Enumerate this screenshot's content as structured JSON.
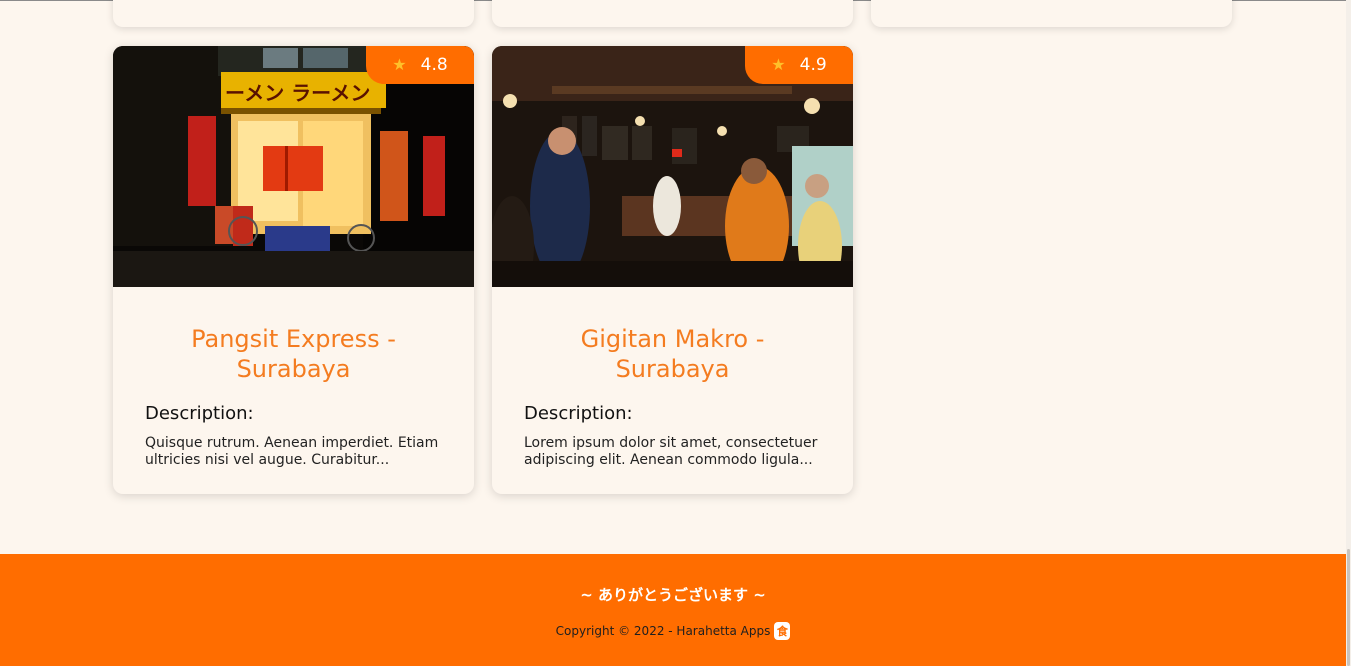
{
  "colors": {
    "accent": "#ff6d00",
    "title": "#f47c20",
    "star": "#ffc02a",
    "background": "#fdf6ee"
  },
  "cards": [
    {
      "name": "Pangsit Express - Surabaya",
      "rating": "4.8",
      "description_label": "Description:",
      "description": "Quisque rutrum. Aenean imperdiet. Etiam ultricies nisi vel augue. Curabitur...",
      "image": "ramen-shop-night-photo"
    },
    {
      "name": "Gigitan Makro - Surabaya",
      "rating": "4.9",
      "description_label": "Description:",
      "description": "Lorem ipsum dolor sit amet, consectetuer adipiscing elit. Aenean commodo ligula...",
      "image": "crowded-cafe-interior-photo"
    }
  ],
  "footer": {
    "thanks": "~ ありがとうございます ~",
    "copyright": "Copyright © 2022 - Harahetta Apps",
    "app_icon": "食"
  },
  "icons": {
    "rating": "star-icon",
    "brand": "app-icon"
  }
}
